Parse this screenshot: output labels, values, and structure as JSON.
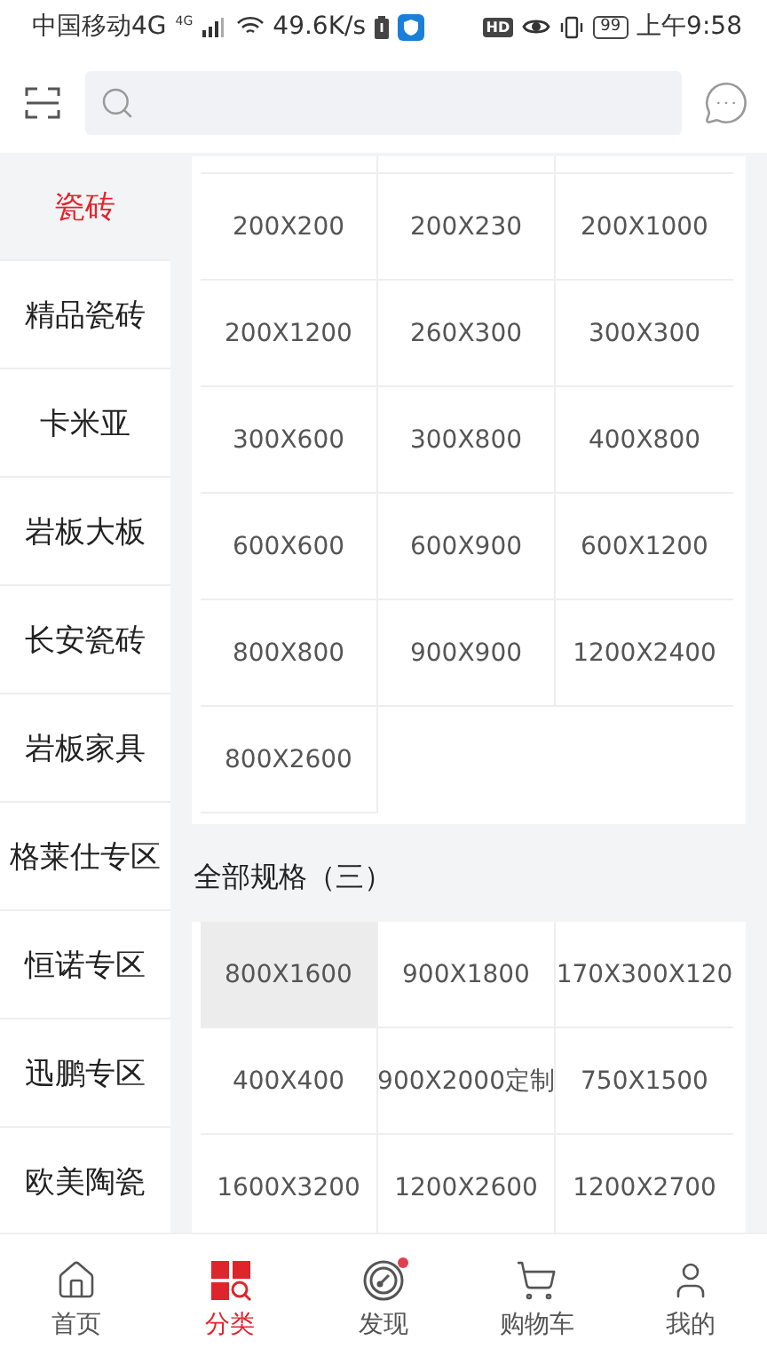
{
  "status_bar": {
    "carrier": "中国移动4G",
    "network_badge": "4G",
    "speed": "49.6K/s",
    "hd_badge": "HD",
    "battery": "99",
    "time": "上午9:58"
  },
  "sidebar": {
    "items": [
      {
        "label": "瓷砖",
        "selected": true
      },
      {
        "label": "精品瓷砖",
        "selected": false
      },
      {
        "label": "卡米亚",
        "selected": false
      },
      {
        "label": "岩板大板",
        "selected": false
      },
      {
        "label": "长安瓷砖",
        "selected": false
      },
      {
        "label": "岩板家具",
        "selected": false
      },
      {
        "label": "格莱仕专区",
        "selected": false
      },
      {
        "label": "恒诺专区",
        "selected": false
      },
      {
        "label": "迅鹏专区",
        "selected": false
      },
      {
        "label": "欧美陶瓷",
        "selected": false
      }
    ]
  },
  "sections": [
    {
      "cut_top": true,
      "cells": [
        {
          "label": "200X200",
          "selected": false
        },
        {
          "label": "200X230",
          "selected": false
        },
        {
          "label": "200X1000",
          "selected": false
        },
        {
          "label": "200X1200",
          "selected": false
        },
        {
          "label": "260X300",
          "selected": false
        },
        {
          "label": "300X300",
          "selected": false
        },
        {
          "label": "300X600",
          "selected": false
        },
        {
          "label": "300X800",
          "selected": false
        },
        {
          "label": "400X800",
          "selected": false
        },
        {
          "label": "600X600",
          "selected": false
        },
        {
          "label": "600X900",
          "selected": false
        },
        {
          "label": "600X1200",
          "selected": false
        },
        {
          "label": "800X800",
          "selected": false
        },
        {
          "label": "900X900",
          "selected": false
        },
        {
          "label": "1200X2400",
          "selected": false
        },
        {
          "label": "800X2600",
          "selected": false
        }
      ]
    },
    {
      "title": "全部规格（三）",
      "cells": [
        {
          "label": "800X1600",
          "selected": true
        },
        {
          "label": "900X1800",
          "selected": false
        },
        {
          "label": "170X300X120",
          "selected": false
        },
        {
          "label": "400X400",
          "selected": false
        },
        {
          "label": "900X2000定制",
          "selected": false
        },
        {
          "label": "750X1500",
          "selected": false
        },
        {
          "label": "1600X3200",
          "selected": false
        },
        {
          "label": "1200X2600",
          "selected": false
        },
        {
          "label": "1200X2700",
          "selected": false
        }
      ]
    }
  ],
  "tab_bar": [
    {
      "kind": "home",
      "label": "首页",
      "selected": false,
      "dot": false
    },
    {
      "kind": "category",
      "label": "分类",
      "selected": true,
      "dot": false
    },
    {
      "kind": "discover",
      "label": "发现",
      "selected": false,
      "dot": true
    },
    {
      "kind": "cart",
      "label": "购物车",
      "selected": false,
      "dot": false
    },
    {
      "kind": "me",
      "label": "我的",
      "selected": false,
      "dot": false
    }
  ]
}
